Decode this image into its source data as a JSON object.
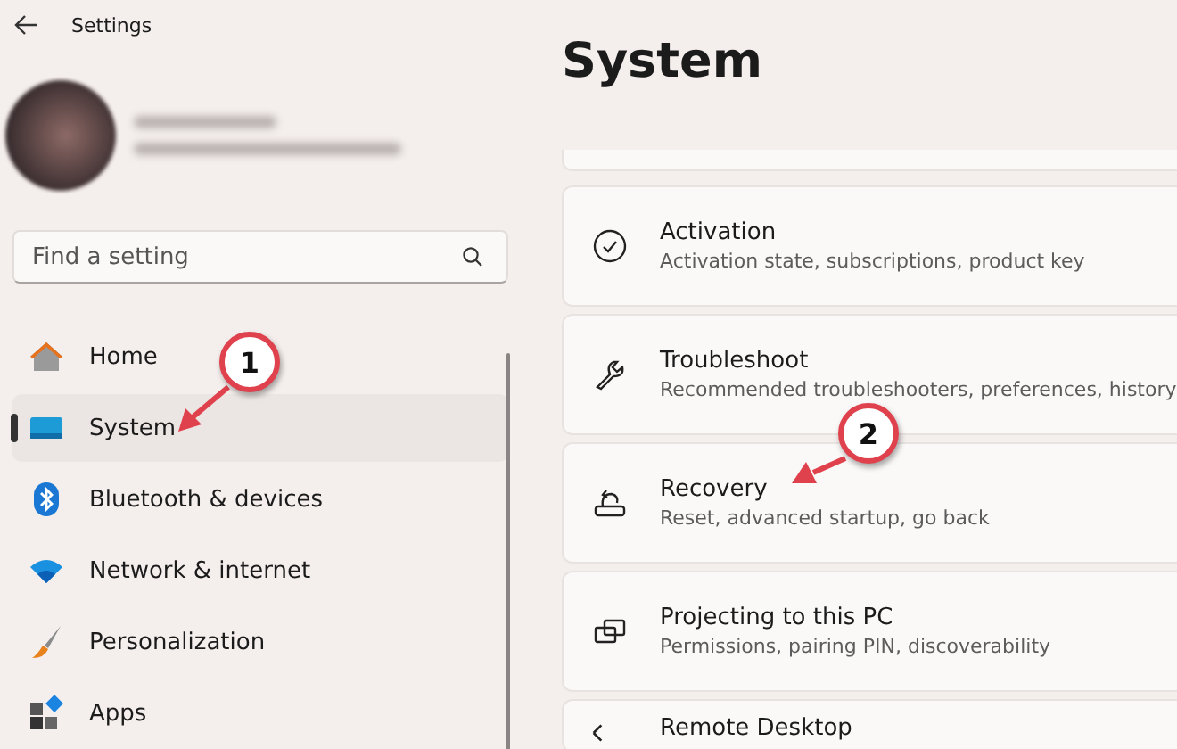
{
  "window": {
    "title": "Settings"
  },
  "search": {
    "placeholder": "Find a setting"
  },
  "nav": [
    {
      "label": "Home",
      "kind": "home",
      "selected": false
    },
    {
      "label": "System",
      "kind": "system",
      "selected": true
    },
    {
      "label": "Bluetooth & devices",
      "kind": "bluetooth",
      "selected": false
    },
    {
      "label": "Network & internet",
      "kind": "network",
      "selected": false
    },
    {
      "label": "Personalization",
      "kind": "brush",
      "selected": false
    },
    {
      "label": "Apps",
      "kind": "apps",
      "selected": false
    }
  ],
  "page": {
    "title": "System"
  },
  "cards": [
    {
      "title": "Activation",
      "subtitle": "Activation state, subscriptions, product key",
      "kind": "check"
    },
    {
      "title": "Troubleshoot",
      "subtitle": "Recommended troubleshooters, preferences, history",
      "kind": "wrench"
    },
    {
      "title": "Recovery",
      "subtitle": "Reset, advanced startup, go back",
      "kind": "recovery"
    },
    {
      "title": "Projecting to this PC",
      "subtitle": "Permissions, pairing PIN, discoverability",
      "kind": "project"
    },
    {
      "title": "Remote Desktop",
      "kind": "remote"
    }
  ],
  "annotations": [
    {
      "label": "1"
    },
    {
      "label": "2"
    }
  ]
}
